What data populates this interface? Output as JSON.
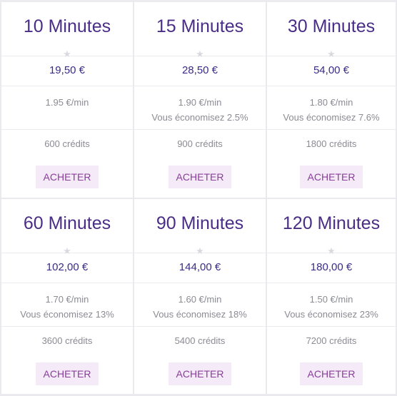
{
  "plans": [
    {
      "title": "10 Minutes",
      "price": "19,50 €",
      "per_min": "1.95 €/min",
      "saving": "",
      "credits": "600 crédits",
      "button": "ACHETER"
    },
    {
      "title": "15 Minutes",
      "price": "28,50 €",
      "per_min": "1.90 €/min",
      "saving": "Vous économisez 2.5%",
      "credits": "900 crédits",
      "button": "ACHETER"
    },
    {
      "title": "30 Minutes",
      "price": "54,00 €",
      "per_min": "1.80 €/min",
      "saving": "Vous économisez 7.6%",
      "credits": "1800 crédits",
      "button": "ACHETER"
    },
    {
      "title": "60 Minutes",
      "price": "102,00 €",
      "per_min": "1.70 €/min",
      "saving": "Vous économisez 13%",
      "credits": "3600 crédits",
      "button": "ACHETER"
    },
    {
      "title": "90 Minutes",
      "price": "144,00 €",
      "per_min": "1.60 €/min",
      "saving": "Vous économisez 18%",
      "credits": "5400 crédits",
      "button": "ACHETER"
    },
    {
      "title": "120 Minutes",
      "price": "180,00 €",
      "per_min": "1.50 €/min",
      "saving": "Vous économisez 23%",
      "credits": "7200 crédits",
      "button": "ACHETER"
    }
  ],
  "icons": {
    "rating": "star-icon"
  },
  "colors": {
    "title": "#4a2d86",
    "price": "#3b2a86",
    "button_bg": "#f5eaf8",
    "button_text": "#8a3e9b",
    "muted_text": "#8b8b94",
    "divider": "#ececf0"
  }
}
